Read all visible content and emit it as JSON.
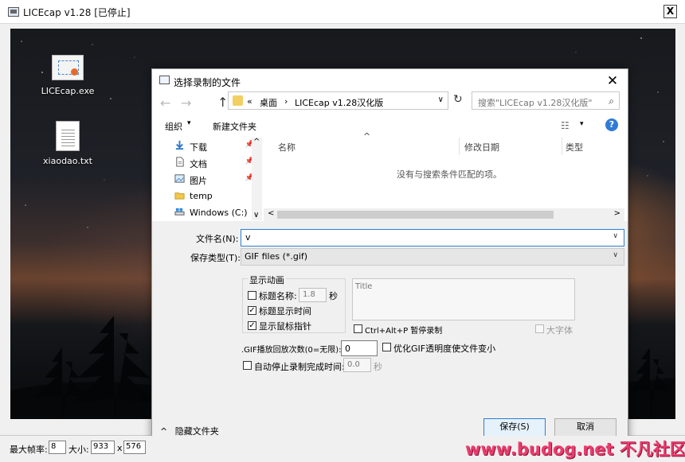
{
  "window": {
    "title": "LICEcap v1.28 [已停止]",
    "close_label": "X"
  },
  "desktop": {
    "items": [
      {
        "label": "LICEcap.exe"
      },
      {
        "label": "xiaodao.txt"
      }
    ]
  },
  "dialog": {
    "title": "选择录制的文件",
    "close_label": "✕",
    "nav": {
      "back_label": "←",
      "forward_label": "→",
      "up_label": "↑",
      "breadcrumb_prefix": "«",
      "breadcrumb": [
        "桌面",
        "LICEcap v1.28汉化版"
      ],
      "breadcrumb_separator": "›",
      "dropdown_label": "∨",
      "refresh_label": "↻",
      "search_placeholder": "搜索\"LICEcap v1.28汉化版\"",
      "search_icon": "⌕"
    },
    "toolbar": {
      "organize_label": "组织",
      "organize_arrow": "▾",
      "new_folder_label": "新建文件夹",
      "view_icon": "☷",
      "view_arrow": "▾",
      "help_label": "?"
    },
    "nav_pane": {
      "items": [
        {
          "label": "下载",
          "icon": "download-icon",
          "pin": "📌"
        },
        {
          "label": "文档",
          "icon": "document-icon",
          "pin": "📌"
        },
        {
          "label": "图片",
          "icon": "picture-icon",
          "pin": "📌"
        },
        {
          "label": "temp",
          "icon": "folder-icon",
          "pin": ""
        },
        {
          "label": "Windows (C:)",
          "icon": "drive-icon",
          "pin": ""
        }
      ],
      "scroll_up": "^",
      "scroll_down": "∨"
    },
    "file_list": {
      "columns": [
        "名称",
        "修改日期",
        "类型"
      ],
      "sort_indicator": "^",
      "empty_message": "没有与搜索条件匹配的项。",
      "scroll_left": "<",
      "scroll_right": ">"
    },
    "filename": {
      "label": "文件名(N):",
      "value": "v",
      "dropdown": "∨"
    },
    "filetype": {
      "label": "保存类型(T):",
      "value": "GIF files (*.gif)",
      "dropdown": "∨"
    },
    "animation_group": {
      "title": "显示动画",
      "title_name_label": "标题名称:",
      "title_name_value": "1.8",
      "title_name_unit": "秒",
      "title_time_label": "标题显示时间",
      "mouse_pointer_label": "显示鼠标指针",
      "checks": {
        "title_name": "",
        "title_time": "✓",
        "mouse_pointer": "✓"
      }
    },
    "title_box": {
      "placeholder": "Title"
    },
    "pause_hotkey_label": "Ctrl+Alt+P 暂停录制",
    "large_font_label": "大字体",
    "loop": {
      "label": ".GIF播放回放次数(0=无限):",
      "value": "0",
      "optimize_label": "优化GIF透明度使文件变小"
    },
    "auto_stop": {
      "label": "自动停止录制完成时间:",
      "value": "0.0",
      "unit": "秒"
    },
    "hide_folders_label": "隐藏文件夹",
    "hide_folders_arrow": "^",
    "save_label": "保存(S)",
    "cancel_label": "取消"
  },
  "statusbar": {
    "fps_label": "最大帧率:",
    "fps_value": "8",
    "size_label": "大小:",
    "width_value": "933",
    "by": "x",
    "height_value": "576"
  },
  "watermark": "www.budog.net 不凡社区",
  "colors": {
    "accent": "#2d7fd3",
    "help": "#2f7bd5",
    "watermark": "#ea3d6f"
  }
}
